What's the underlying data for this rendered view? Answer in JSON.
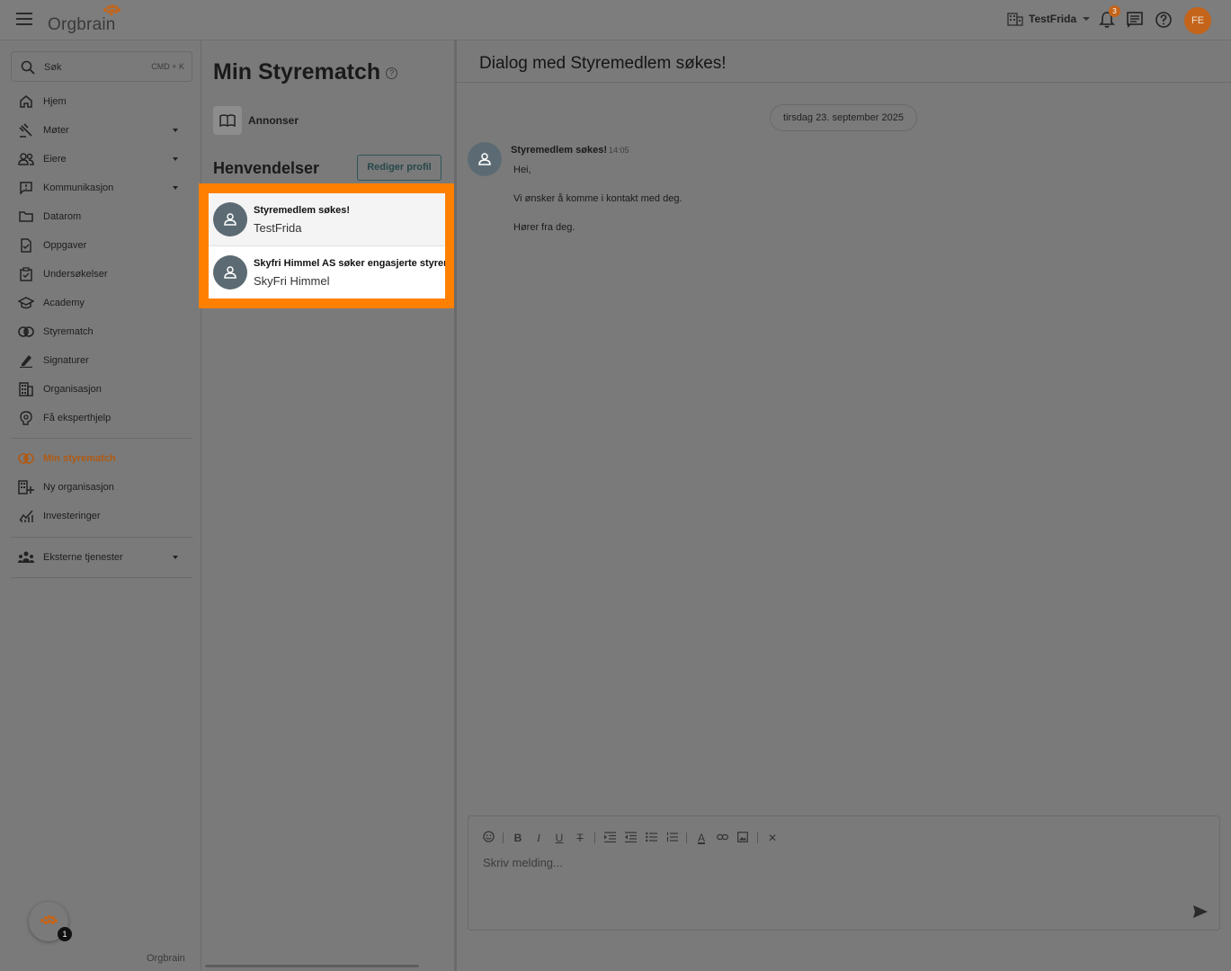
{
  "app": {
    "logo_text": "Orgbrain",
    "org_name": "TestFrida",
    "notification_count": "3",
    "user_initials": "FE"
  },
  "sidebar": {
    "search_placeholder": "Søk",
    "search_shortcut": "CMD + K",
    "main_items": [
      {
        "label": "Hjem",
        "icon": "home-icon"
      },
      {
        "label": "Møter",
        "icon": "gavel-icon",
        "expandable": true
      },
      {
        "label": "Eiere",
        "icon": "people-icon",
        "expandable": true
      },
      {
        "label": "Kommunikasjon",
        "icon": "chat-icon",
        "expandable": true
      },
      {
        "label": "Datarom",
        "icon": "folder-icon"
      },
      {
        "label": "Oppgaver",
        "icon": "task-icon"
      },
      {
        "label": "Undersøkelser",
        "icon": "survey-icon"
      },
      {
        "label": "Academy",
        "icon": "graduation-cap-icon"
      },
      {
        "label": "Styrematch",
        "icon": "styrematch-icon"
      },
      {
        "label": "Signaturer",
        "icon": "signature-icon"
      },
      {
        "label": "Organisasjon",
        "icon": "building-icon"
      },
      {
        "label": "Få eksperthjelp",
        "icon": "expert-help-icon"
      }
    ],
    "secondary_items": [
      {
        "label": "Min styrematch",
        "icon": "styrematch-icon",
        "active": true
      },
      {
        "label": "Ny organisasjon",
        "icon": "new-building-icon"
      },
      {
        "label": "Investeringer",
        "icon": "chart-icon"
      }
    ],
    "tertiary_items": [
      {
        "label": "Eksterne tjenester",
        "icon": "group-icon",
        "expandable": true
      }
    ],
    "help_badge": "1",
    "footer_logo": "Orgbrain"
  },
  "middle": {
    "title": "Min Styrematch",
    "help_glyph": "?",
    "annonser_label": "Annonser",
    "henvendelser_label": "Henvendelser",
    "edit_profile_label": "Rediger profil",
    "threads": [
      {
        "title": "Styremedlem søkes!",
        "subtitle": "TestFrida",
        "selected": true
      },
      {
        "title": "Skyfri Himmel AS søker engasjerte styremedlemmer",
        "subtitle": "SkyFri Himmel",
        "selected": false
      }
    ]
  },
  "chat": {
    "title": "Dialog med Styremedlem søkes!",
    "date": "tirsdag 23. september 2025",
    "message": {
      "sender": "Styremedlem søkes!",
      "time": "14:05",
      "lines": [
        "Hei,",
        "Vi ønsker å komme i kontakt med deg.",
        "Hører fra deg."
      ]
    },
    "composer_placeholder": "Skriv melding...",
    "toolbar": [
      "emoji-icon",
      "bold-icon",
      "italic-icon",
      "underline-icon",
      "strikethrough-icon",
      "indent-icon",
      "outdent-icon",
      "bullet-list-icon",
      "numbered-list-icon",
      "text-color-icon",
      "link-icon",
      "image-icon",
      "clear-format-icon"
    ]
  }
}
